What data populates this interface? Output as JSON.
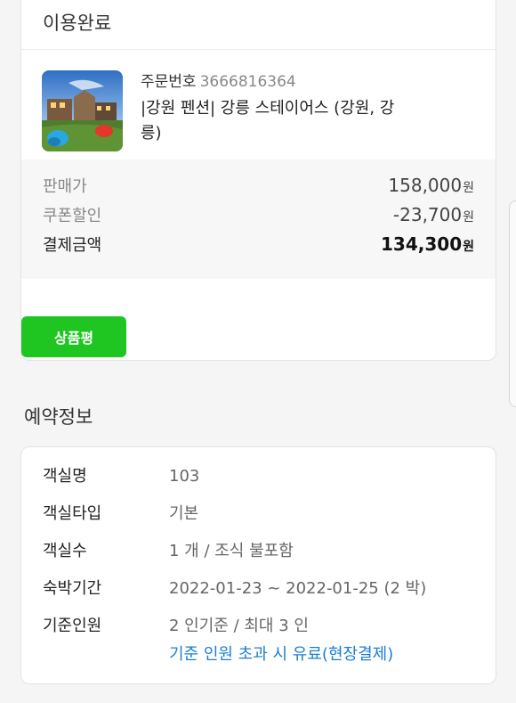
{
  "order": {
    "status_title": "이용완료",
    "order_no_label": "주문번호",
    "order_no": "3666816364",
    "product_name": "|강원 펜션| 강릉 스테이어스 (강원, 강릉)",
    "prices": [
      {
        "label": "판매가",
        "amount": "158,000",
        "unit": "원"
      },
      {
        "label": "쿠폰할인",
        "amount": "-23,700",
        "unit": "원"
      },
      {
        "label": "결제금액",
        "amount": "134,300",
        "unit": "원"
      }
    ],
    "review_button": "상품평"
  },
  "reservation": {
    "section_title": "예약정보",
    "rows": [
      {
        "label": "객실명",
        "value": "103"
      },
      {
        "label": "객실타입",
        "value": "기본"
      },
      {
        "label": "객실수",
        "value": "1 개 / 조식 불포함"
      },
      {
        "label": "숙박기간",
        "value": "2022-01-23 ~ 2022-01-25 (2 박)"
      },
      {
        "label": "기준인원",
        "value": "2 인기준 / 최대 3 인",
        "note": "기준 인원 초과 시 유료(현장결제)"
      }
    ]
  },
  "colors": {
    "accent_green": "#1fc622",
    "link_blue": "#1a7fd1"
  }
}
